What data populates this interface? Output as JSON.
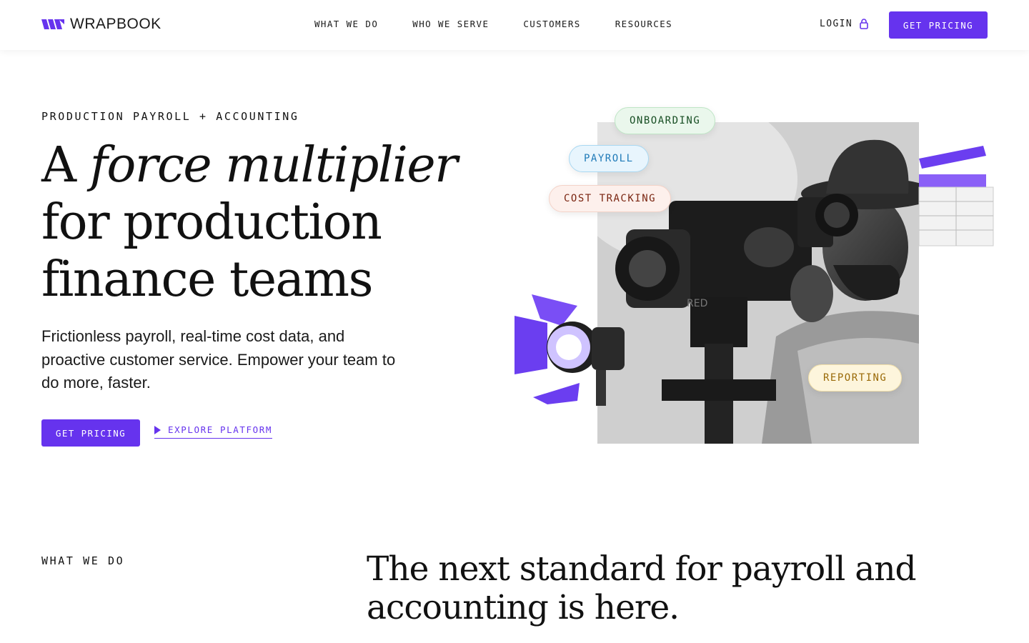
{
  "header": {
    "brand": "WRAPBOOK",
    "nav": [
      "WHAT WE DO",
      "WHO WE SERVE",
      "CUSTOMERS",
      "RESOURCES"
    ],
    "login_label": "LOGIN",
    "cta_label": "GET PRICING"
  },
  "hero": {
    "eyebrow": "PRODUCTION PAYROLL + ACCOUNTING",
    "headline_lead": "A ",
    "headline_emphasis": "force multiplier",
    "headline_rest_1": "for production",
    "headline_rest_2": "finance teams",
    "subcopy": "Frictionless payroll, real-time cost data, and proactive customer service. Empower your team to do more, faster.",
    "primary_cta": "GET PRICING",
    "secondary_cta": "EXPLORE PLATFORM",
    "tags": {
      "onboarding": "ONBOARDING",
      "payroll": "PAYROLL",
      "cost_tracking": "COST TRACKING",
      "reporting": "REPORTING"
    }
  },
  "section": {
    "label": "WHAT WE DO",
    "title": "The next standard for payroll and accounting is here."
  },
  "colors": {
    "accent": "#6633ee",
    "text": "#111111",
    "background": "#ffffff"
  },
  "icons": {
    "logo": "wrapbook-logo-icon",
    "lock": "lock-icon",
    "play": "play-icon"
  }
}
